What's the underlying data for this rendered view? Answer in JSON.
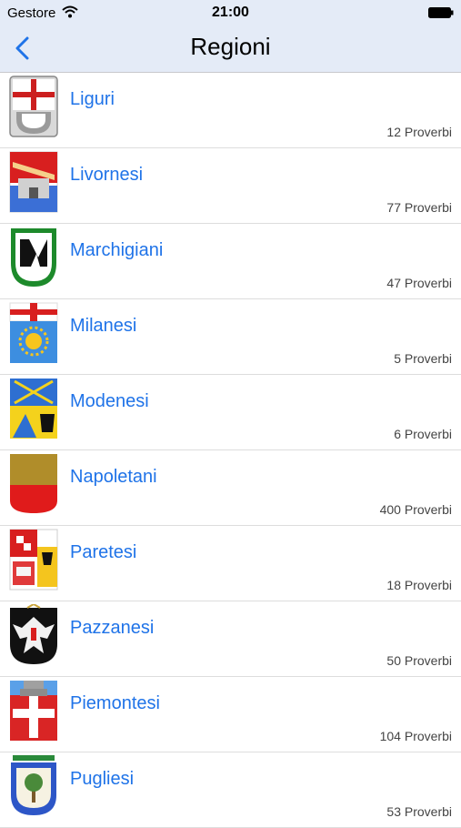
{
  "status_bar": {
    "carrier": "Gestore",
    "time": "21:00"
  },
  "nav": {
    "title": "Regioni"
  },
  "rows": [
    {
      "name": "Liguri",
      "count": "12 Proverbi",
      "crest_icon": "liguria-crest-icon"
    },
    {
      "name": "Livornesi",
      "count": "77 Proverbi",
      "crest_icon": "livorno-crest-icon"
    },
    {
      "name": "Marchigiani",
      "count": "47 Proverbi",
      "crest_icon": "marche-crest-icon"
    },
    {
      "name": "Milanesi",
      "count": "5 Proverbi",
      "crest_icon": "milano-crest-icon"
    },
    {
      "name": "Modenesi",
      "count": "6 Proverbi",
      "crest_icon": "modena-crest-icon"
    },
    {
      "name": "Napoletani",
      "count": "400 Proverbi",
      "crest_icon": "napoli-crest-icon"
    },
    {
      "name": "Paretesi",
      "count": "18 Proverbi",
      "crest_icon": "parete-crest-icon"
    },
    {
      "name": "Pazzanesi",
      "count": "50 Proverbi",
      "crest_icon": "pazzano-crest-icon"
    },
    {
      "name": "Piemontesi",
      "count": "104 Proverbi",
      "crest_icon": "piemonte-crest-icon"
    },
    {
      "name": "Pugliesi",
      "count": "53 Proverbi",
      "crest_icon": "puglia-crest-icon"
    }
  ],
  "colors": {
    "accent": "#1f73e8",
    "bar_background": "#e4ebf7"
  }
}
